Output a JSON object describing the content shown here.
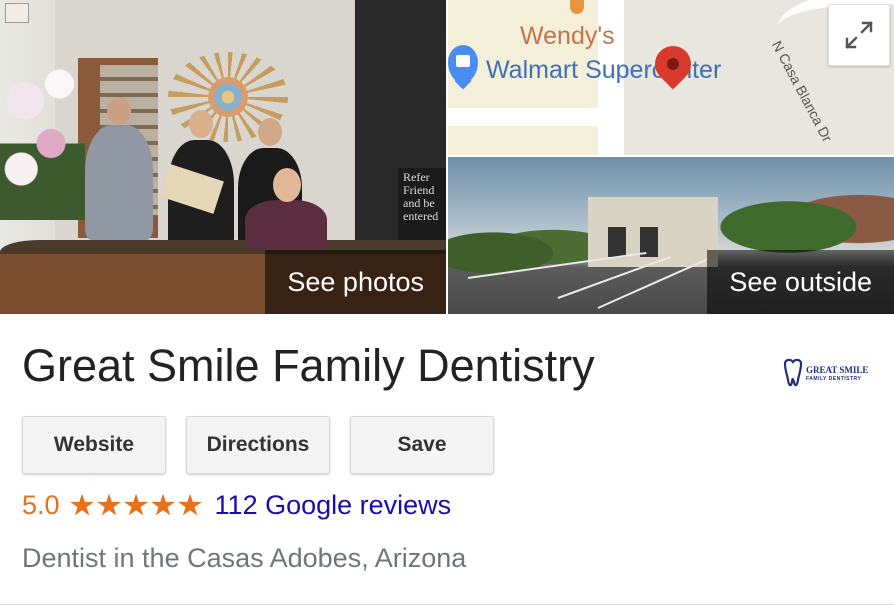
{
  "photos": {
    "see_photos_label": "See photos",
    "see_outside_label": "See outside",
    "board_text": "Refer\nFriend\nand be\nentered",
    "map": {
      "poi_1": "Wendy's",
      "poi_2": "Walmart Supercenter",
      "street": "N Casa Blanca Dr"
    }
  },
  "business": {
    "name": "Great Smile Family Dentistry",
    "logo_text_1": "GREAT SMILE",
    "logo_text_2": "FAMILY DENTISTRY",
    "category": "Dentist in the Casas Adobes, Arizona"
  },
  "actions": {
    "website_label": "Website",
    "directions_label": "Directions",
    "save_label": "Save"
  },
  "rating": {
    "value": "5.0",
    "stars": 5,
    "reviews_label": "112 Google reviews"
  },
  "colors": {
    "rating_orange": "#e7711b",
    "link_blue": "#1a0dab",
    "pin_red": "#d93a2b"
  },
  "icons": [
    "expand-icon",
    "map-pin-icon",
    "walmart-pin-icon",
    "star-icon",
    "tooth-logo-icon"
  ]
}
